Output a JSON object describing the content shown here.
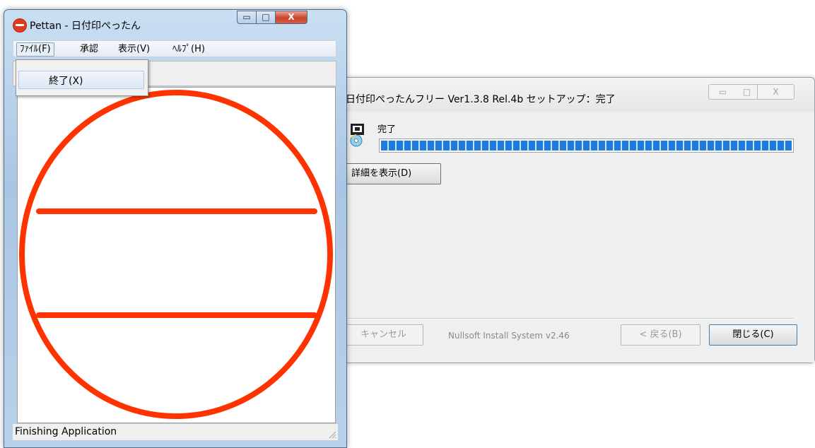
{
  "setup": {
    "title": "日付印ぺったんフリー Ver1.3.8 Rel.4b セットアップ：完了",
    "caption_min": "▭",
    "caption_max": "□",
    "caption_close": "X",
    "status_label": "完了",
    "progress": 1.0,
    "show_details_label": "詳細を表示(D)",
    "cancel_label": "キャンセル",
    "branding": "Nullsoft Install System v2.46",
    "back_label": "< 戻る(B)",
    "close_label": "閉じる(C)"
  },
  "pettan": {
    "title": "Pettan - 日付印ぺったん",
    "caption_min": "▭",
    "caption_max": "□",
    "caption_close": "X",
    "menu": {
      "file": "ﾌｧｲﾙ(F)",
      "approve": "承認",
      "view": "表示(V)",
      "help": "ﾍﾙﾌﾟ(H)"
    },
    "dropdown": {
      "exit": "終了(X)"
    },
    "status": "Finishing Application",
    "stamp_color": "#ff3300"
  }
}
